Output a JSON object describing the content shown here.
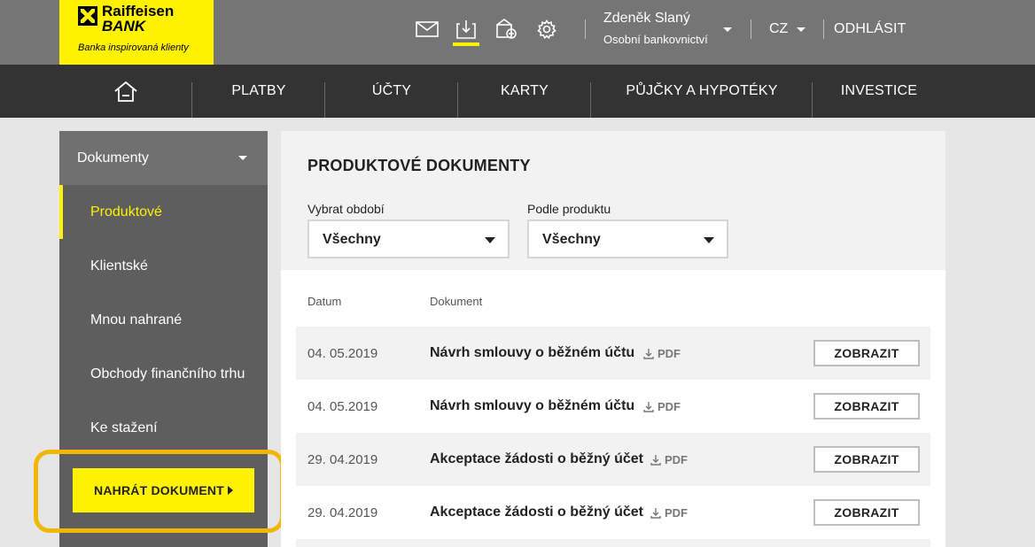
{
  "brand": {
    "name": "Raiffeisen",
    "bank": "BANK",
    "tagline": "Banka inspirovaná klienty",
    "accent": "#fff200"
  },
  "header": {
    "icons": [
      "mail-icon",
      "download-icon",
      "exchange-icon",
      "gear-icon"
    ],
    "user_name": "Zdeněk Slaný",
    "user_role": "Osobní bankovnictví",
    "language": "CZ",
    "logout": "ODHLÁSIT"
  },
  "nav": {
    "home_icon": "home-icon",
    "items": [
      "PLATBY",
      "ÚČTY",
      "KARTY",
      "PŮJČKY A HYPOTÉKY",
      "INVESTICE"
    ]
  },
  "sidebar": {
    "title": "Dokumenty",
    "items": [
      "Produktové",
      "Klientské",
      "Mnou nahrané",
      "Obchody finančního trhu",
      "Ke stažení"
    ],
    "active": "Produktové",
    "upload_label": "NAHRÁT DOKUMENT"
  },
  "content": {
    "title": "PRODUKTOVÉ DOKUMENTY",
    "filters": {
      "period_label": "Vybrat období",
      "period_value": "Všechny",
      "product_label": "Podle produktu",
      "product_value": "Všechny"
    },
    "columns": {
      "date": "Datum",
      "document": "Dokument"
    },
    "rows": [
      {
        "date": "04. 05.2019",
        "document": "Návrh smlouvy o běžném účtu",
        "format": "PDF",
        "action": "ZOBRAZIT"
      },
      {
        "date": "04. 05.2019",
        "document": "Návrh smlouvy o běžném účtu",
        "format": "PDF",
        "action": "ZOBRAZIT"
      },
      {
        "date": "29. 04.2019",
        "document": "Akceptace žádosti o běžný účet",
        "format": "PDF",
        "action": "ZOBRAZIT"
      },
      {
        "date": "29. 04.2019",
        "document": "Akceptace žádosti o běžný účet",
        "format": "PDF",
        "action": "ZOBRAZIT"
      }
    ]
  }
}
